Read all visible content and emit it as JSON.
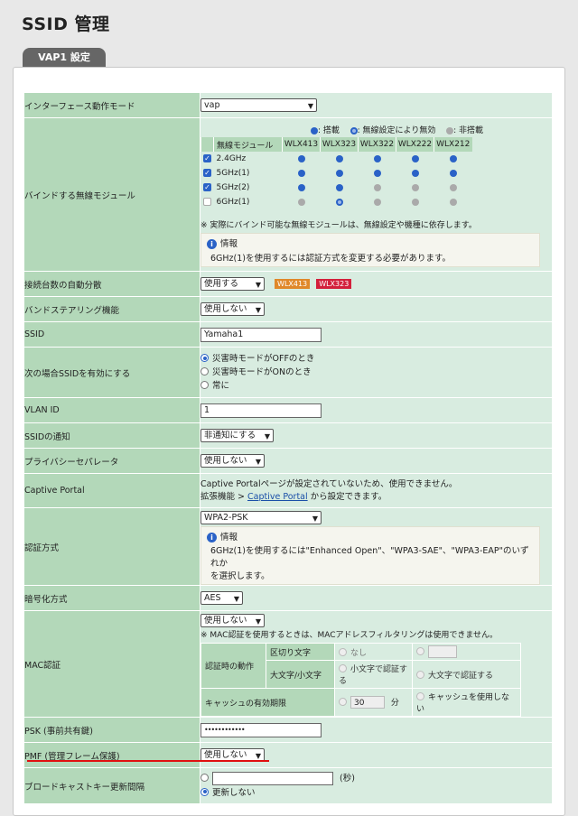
{
  "page_title": "SSID 管理",
  "panel_tab": "VAP1 設定",
  "rows": {
    "iface_mode": {
      "label": "インターフェース動作モード",
      "value": "vap"
    },
    "bind_modules": {
      "label": "バインドする無線モジュール",
      "legend": {
        "mounted": ": 搭載",
        "disabled_by_setting": ": 無線設定により無効",
        "not_mounted": ": 非搭載"
      },
      "header_module": "無線モジュール",
      "models": [
        "WLX413",
        "WLX323",
        "WLX322",
        "WLX222",
        "WLX212"
      ],
      "modules": [
        {
          "name": "2.4GHz",
          "checked": true,
          "status": [
            "blue",
            "blue",
            "blue",
            "blue",
            "blue"
          ]
        },
        {
          "name": "5GHz(1)",
          "checked": true,
          "status": [
            "blue",
            "blue",
            "blue",
            "blue",
            "blue"
          ]
        },
        {
          "name": "5GHz(2)",
          "checked": true,
          "status": [
            "blue",
            "blue",
            "gray",
            "gray",
            "gray"
          ]
        },
        {
          "name": "6GHz(1)",
          "checked": false,
          "status": [
            "gray",
            "ring",
            "gray",
            "gray",
            "gray"
          ]
        }
      ],
      "note": "※ 実際にバインド可能な無線モジュールは、無線設定や機種に依存します。",
      "info_title": "情報",
      "info_text": "6GHz(1)を使用するには認証方式を変更する必要があります。"
    },
    "auto_distribute": {
      "label": "接続台数の自動分散",
      "value": "使用する",
      "badge1": "WLX413",
      "badge2": "WLX323"
    },
    "band_steering": {
      "label": "バンドステアリング機能",
      "value": "使用しない"
    },
    "ssid": {
      "label": "SSID",
      "value": "Yamaha1"
    },
    "ssid_enable": {
      "label": "次の場合SSIDを有効にする",
      "opt1": "災害時モードがOFFのとき",
      "opt2": "災害時モードがONのとき",
      "opt3": "常に"
    },
    "vlan_id": {
      "label": "VLAN ID",
      "value": "1"
    },
    "ssid_notify": {
      "label": "SSIDの通知",
      "value": "非通知にする"
    },
    "privacy_sep": {
      "label": "プライバシーセパレータ",
      "value": "使用しない"
    },
    "captive": {
      "label": "Captive Portal",
      "line1": "Captive Portalページが設定されていないため、使用できません。",
      "line2_pre": "拡張機能 > ",
      "line2_link": "Captive Portal",
      "line2_post": " から設定できます。"
    },
    "auth": {
      "label": "認証方式",
      "value": "WPA2-PSK",
      "info_title": "情報",
      "info_text1": "6GHz(1)を使用するには\"Enhanced Open\"、\"WPA3-SAE\"、\"WPA3-EAP\"のいずれか",
      "info_text2": "を選択します。"
    },
    "encryption": {
      "label": "暗号化方式",
      "value": "AES"
    },
    "mac_auth": {
      "label": "MAC認証",
      "value": "使用しない",
      "note": "※ MAC認証を使用するときは、MACアドレスフィルタリングは使用できません。",
      "action_label": "認証時の動作",
      "delim_label": "区切り文字",
      "delim_none": "なし",
      "case_label": "大文字/小文字",
      "case_lower": "小文字で認証する",
      "case_upper": "大文字で認証する",
      "cache_label": "キャッシュの有効期限",
      "cache_value": "30",
      "cache_unit": "分",
      "cache_none": "キャッシュを使用しない"
    },
    "psk": {
      "label": "PSK (事前共有鍵)",
      "value": "••••••••••••"
    },
    "pmf": {
      "label": "PMF (管理フレーム保護)",
      "value": "使用しない"
    },
    "broadcast_key": {
      "label": "ブロードキャストキー更新間隔",
      "unit": "(秒)",
      "opt_no_update": "更新しない"
    }
  },
  "colors": {
    "label_bg": "#b3d8b9",
    "value_bg": "#d8ece0",
    "accent": "#2a62c7",
    "highlight": "#e01010",
    "badge1": "#e0882a",
    "badge2": "#d3203c"
  }
}
